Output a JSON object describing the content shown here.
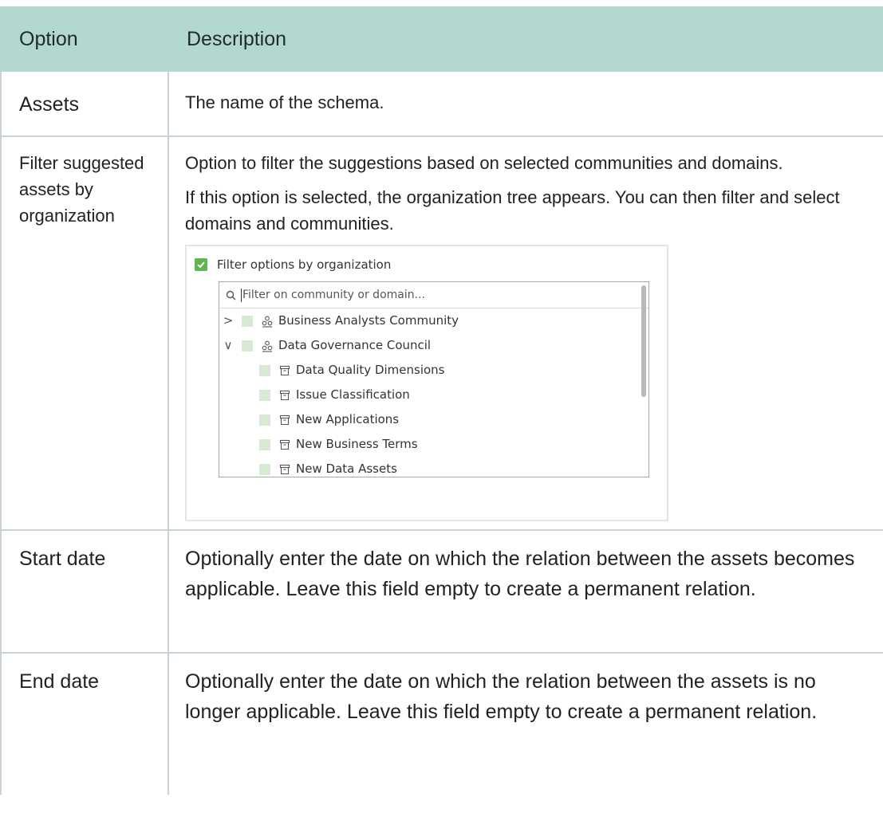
{
  "table": {
    "headers": {
      "option": "Option",
      "description": "Description"
    },
    "rows": [
      {
        "option": "Assets",
        "description": [
          "The name of the schema."
        ]
      },
      {
        "option": "Filter suggested assets by organization",
        "description": [
          "Option to filter the suggestions based on selected communities and domains.",
          "If this option is selected, the organization tree appears. You can then filter and select domains and communities."
        ]
      },
      {
        "option": "Start date",
        "description": [
          "Optionally enter the date on which the relation between the assets becomes applicable. Leave this field empty to create a permanent relation."
        ]
      },
      {
        "option": "End date",
        "description": [
          "Optionally enter the date on which the relation between the assets is no longer applicable. Leave this field empty to create a permanent relation."
        ]
      }
    ]
  },
  "embed": {
    "checkbox_label": "Filter options by organization",
    "checkbox_checked": true,
    "search_placeholder": "Filter on community or domain...",
    "tree": [
      {
        "label": "Business Analysts Community",
        "type": "community",
        "chevron": ">"
      },
      {
        "label": "Data Governance Council",
        "type": "community",
        "chevron": "∨"
      },
      {
        "label": "Data Quality Dimensions",
        "type": "domain"
      },
      {
        "label": "Issue Classification",
        "type": "domain"
      },
      {
        "label": "New Applications",
        "type": "domain"
      },
      {
        "label": "New Business Terms",
        "type": "domain"
      },
      {
        "label": "New Data Assets",
        "type": "domain"
      }
    ],
    "colors": {
      "header_bg": "#b2d8cf",
      "checkbox": "#5fb54e",
      "tree_square": "#d7ebd2"
    }
  }
}
